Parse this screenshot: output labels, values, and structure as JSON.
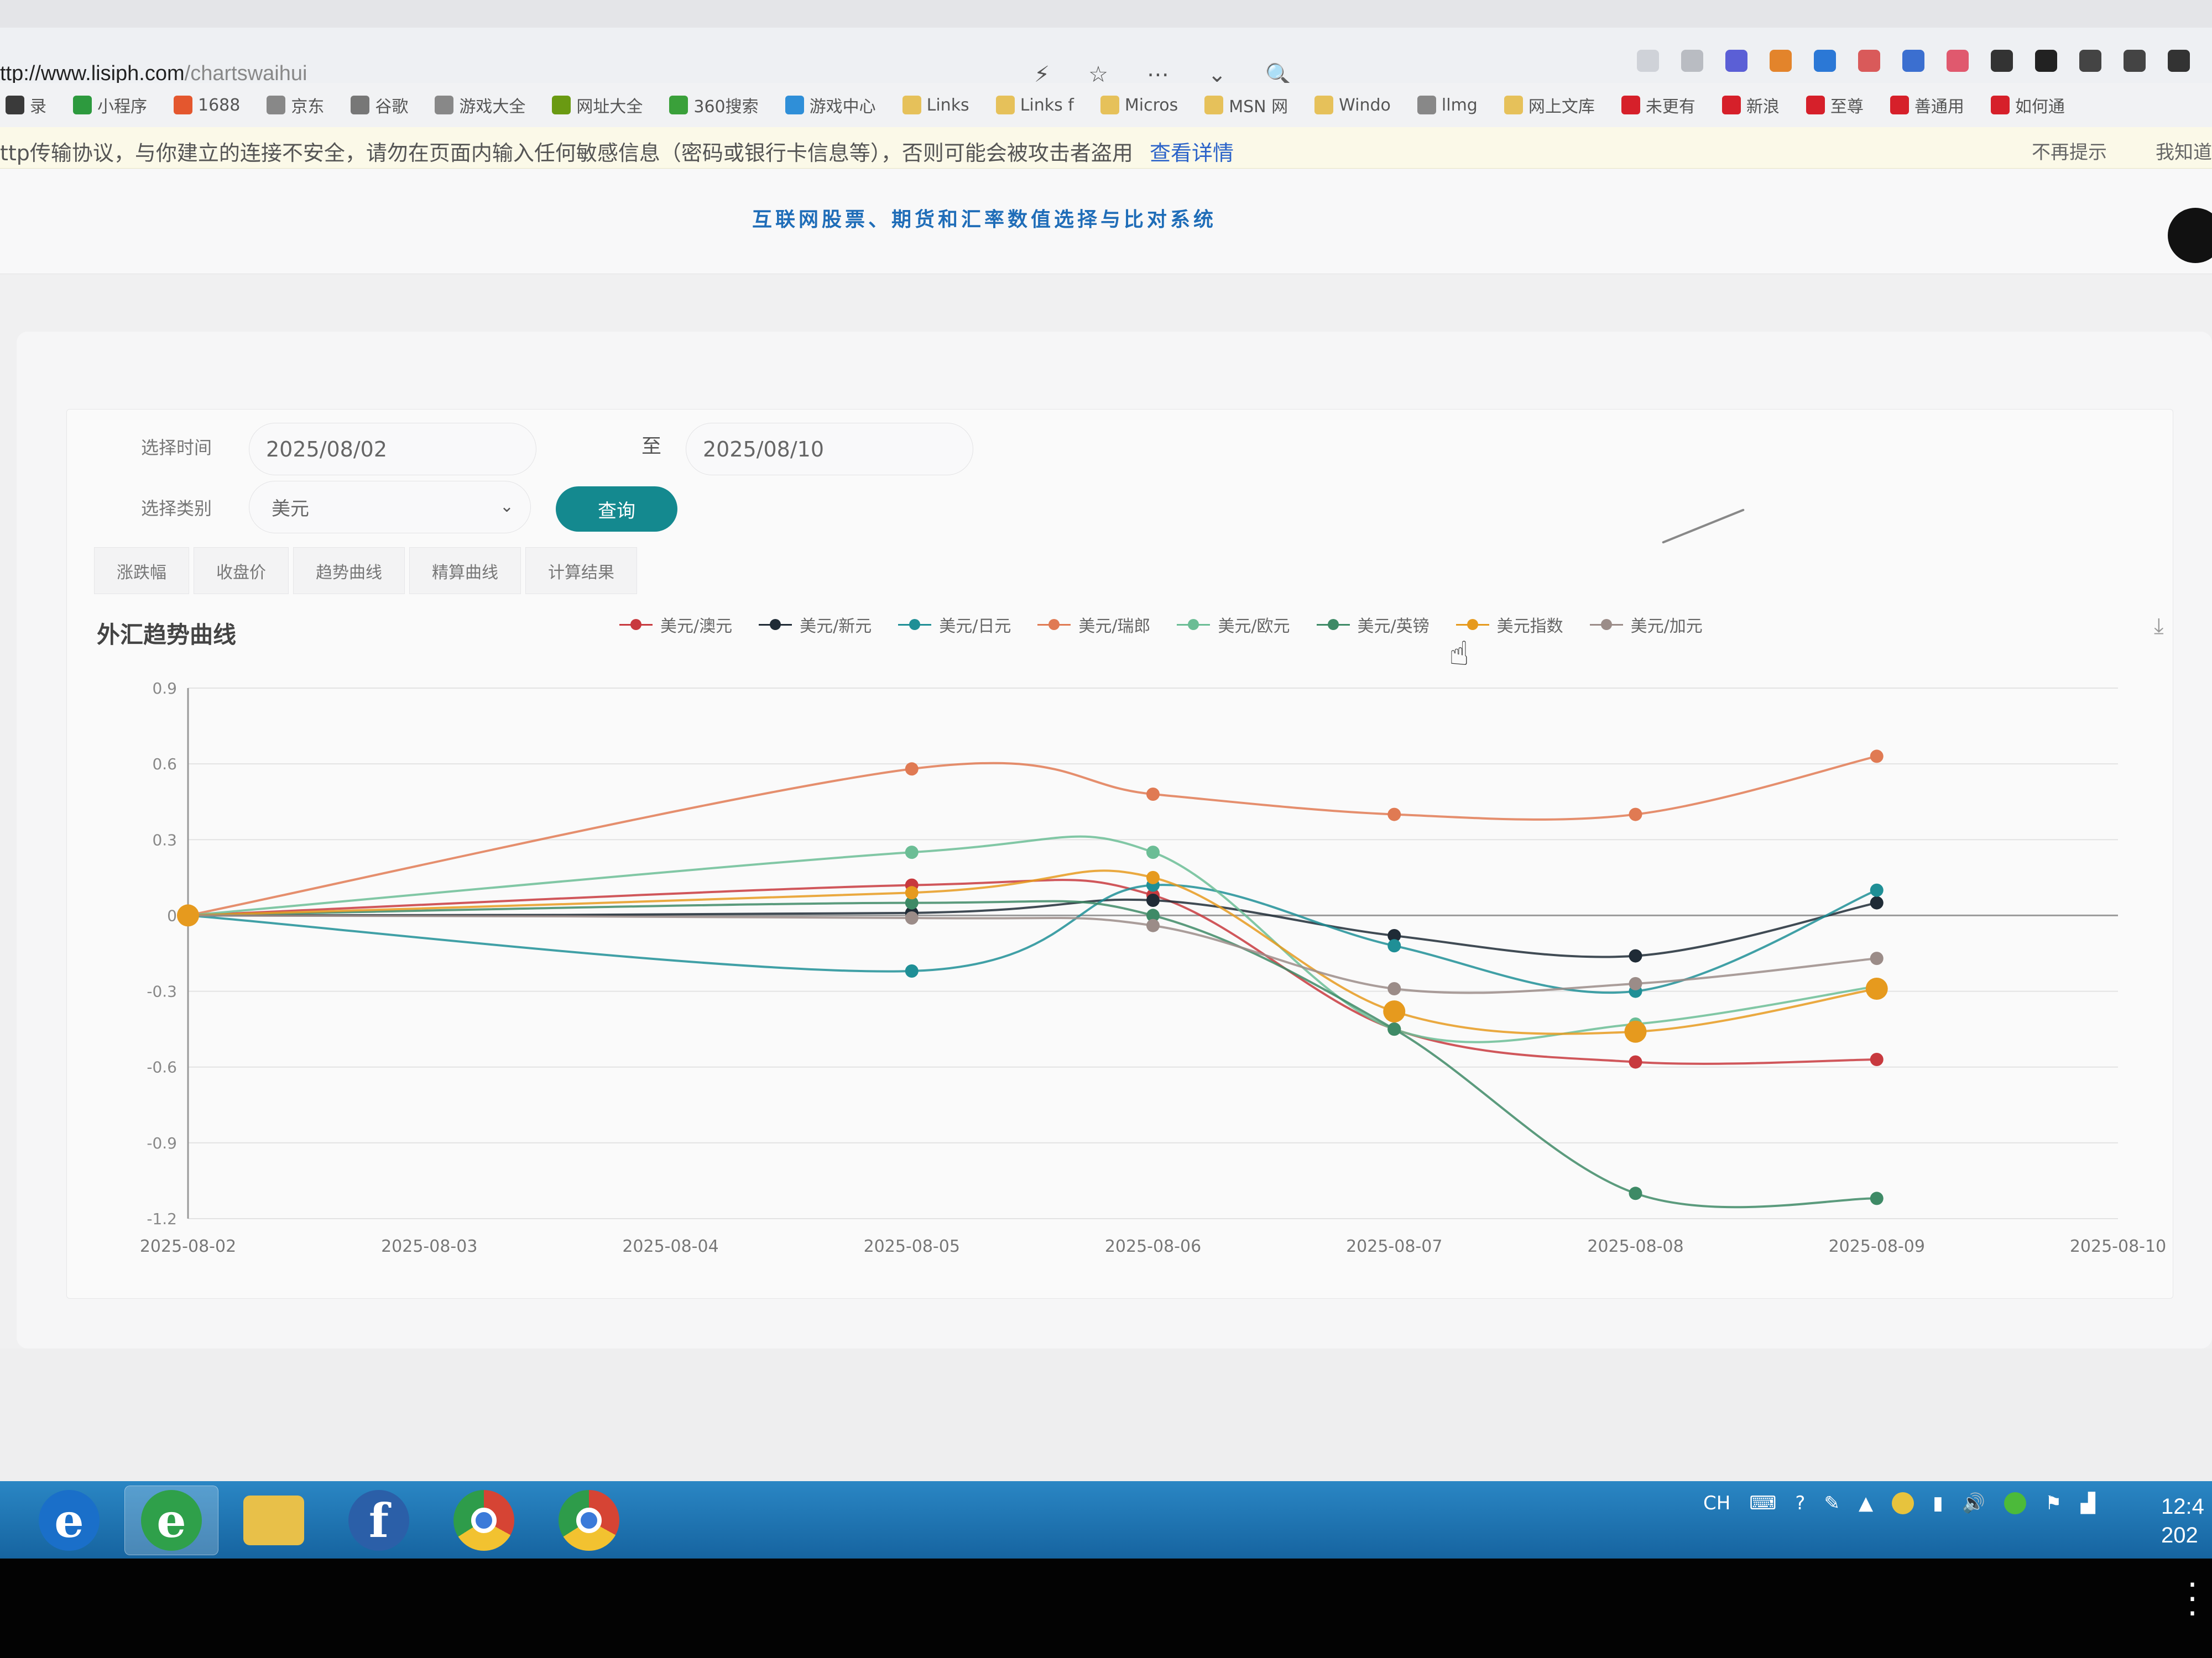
{
  "browser": {
    "url": "ttp://www.lisiph.com/chartswaihui",
    "url_domain": "ttp://www.lisiph.com",
    "url_path": "/chartswaihui",
    "bookmarks": [
      {
        "label": "录",
        "icon": "folder-icon",
        "color": "#3a3a3a"
      },
      {
        "label": "小程序",
        "icon": "app-icon",
        "color": "#2d9a3e"
      },
      {
        "label": "1688",
        "icon": "shop-icon",
        "color": "#e4572e"
      },
      {
        "label": "京东",
        "icon": "link-icon",
        "color": "#888888"
      },
      {
        "label": "谷歌",
        "icon": "google-icon",
        "color": "#777777"
      },
      {
        "label": "游戏大全",
        "icon": "link-icon",
        "color": "#888888"
      },
      {
        "label": "网址大全",
        "icon": "globe-icon",
        "color": "#6a9a12"
      },
      {
        "label": "360搜索",
        "icon": "search-icon",
        "color": "#3aa03a"
      },
      {
        "label": "游戏中心",
        "icon": "game-icon",
        "color": "#2f8fd8"
      },
      {
        "label": "Links",
        "icon": "folder-icon",
        "color": "#e6c15a"
      },
      {
        "label": "Links f",
        "icon": "folder-icon",
        "color": "#e6c15a"
      },
      {
        "label": "Micros",
        "icon": "folder-icon",
        "color": "#e6c15a"
      },
      {
        "label": "MSN 网",
        "icon": "folder-icon",
        "color": "#e6c15a"
      },
      {
        "label": "Windo",
        "icon": "folder-icon",
        "color": "#e6c15a"
      },
      {
        "label": "llmg",
        "icon": "link-icon",
        "color": "#888888"
      },
      {
        "label": "网上文库",
        "icon": "folder-icon",
        "color": "#e6c15a"
      },
      {
        "label": "未更有",
        "icon": "weibo-icon",
        "color": "#d6202a"
      },
      {
        "label": "新浪",
        "icon": "weibo-icon",
        "color": "#d6202a"
      },
      {
        "label": "至尊",
        "icon": "weibo-icon",
        "color": "#d6202a"
      },
      {
        "label": "善通用",
        "icon": "weibo-icon",
        "color": "#d6202a"
      },
      {
        "label": "如何通",
        "icon": "weibo-icon",
        "color": "#d6202a"
      }
    ],
    "warning": {
      "text": "ttp传输协议，与你建立的连接不安全，请勿在页面内输入任何敏感信息（密码或银行卡信息等），否则可能会被攻击者盗用",
      "link": "查看详情",
      "dismiss": "不再提示",
      "ok": "我知道"
    }
  },
  "page": {
    "title": "互联网股票、期货和汇率数值选择与比对系统"
  },
  "form": {
    "time_label": "选择时间",
    "start_date": "2025/08/02",
    "to_label": "至",
    "end_date": "2025/08/10",
    "category_label": "选择类别",
    "category_value": "美元",
    "query_button": "查询"
  },
  "tabs": [
    {
      "label": "涨跌幅"
    },
    {
      "label": "收盘价"
    },
    {
      "label": "趋势曲线"
    },
    {
      "label": "精算曲线"
    },
    {
      "label": "计算结果"
    }
  ],
  "chart_data": {
    "type": "line",
    "title": "外汇趋势曲线",
    "x": [
      "2025-08-02",
      "2025-08-03",
      "2025-08-04",
      "2025-08-05",
      "2025-08-06",
      "2025-08-07",
      "2025-08-08",
      "2025-08-09",
      "2025-08-10"
    ],
    "ylim": [
      -1.2,
      0.9
    ],
    "yticks": [
      0.9,
      0.6,
      0.3,
      0,
      -0.3,
      -0.6,
      -0.9,
      -1.2
    ],
    "grid": true,
    "legend_position": "top",
    "series": [
      {
        "name": "美元/澳元",
        "color": "#c8393e",
        "points": [
          [
            0,
            0
          ],
          [
            3,
            0.12
          ],
          [
            4,
            0.08
          ],
          [
            5,
            -0.45
          ],
          [
            6,
            -0.58
          ],
          [
            7,
            -0.57
          ]
        ]
      },
      {
        "name": "美元/新元",
        "color": "#1f2b36",
        "points": [
          [
            0,
            0
          ],
          [
            3,
            0.01
          ],
          [
            4,
            0.06
          ],
          [
            5,
            -0.08
          ],
          [
            6,
            -0.16
          ],
          [
            7,
            0.05
          ]
        ]
      },
      {
        "name": "美元/日元",
        "color": "#1f8f96",
        "points": [
          [
            0,
            0
          ],
          [
            3,
            -0.22
          ],
          [
            4,
            0.12
          ],
          [
            5,
            -0.12
          ],
          [
            6,
            -0.3
          ],
          [
            7,
            0.1
          ]
        ]
      },
      {
        "name": "美元/瑞郎",
        "color": "#e07a53",
        "points": [
          [
            0,
            0
          ],
          [
            3,
            0.58
          ],
          [
            4,
            0.48
          ],
          [
            5,
            0.4
          ],
          [
            6,
            0.4
          ],
          [
            7,
            0.63
          ]
        ]
      },
      {
        "name": "美元/欧元",
        "color": "#6bbd95",
        "points": [
          [
            0,
            0
          ],
          [
            3,
            0.25
          ],
          [
            4,
            0.25
          ],
          [
            5,
            -0.45
          ],
          [
            6,
            -0.43
          ],
          [
            7,
            -0.28
          ]
        ]
      },
      {
        "name": "美元/英镑",
        "color": "#3e8a66",
        "points": [
          [
            0,
            0
          ],
          [
            3,
            0.05
          ],
          [
            4,
            0.0
          ],
          [
            5,
            -0.45
          ],
          [
            6,
            -1.1
          ],
          [
            7,
            -1.12
          ]
        ]
      },
      {
        "name": "美元指数",
        "color": "#e69a1e",
        "points": [
          [
            0,
            0
          ],
          [
            3,
            0.09
          ],
          [
            4,
            0.15
          ],
          [
            5,
            -0.38
          ],
          [
            6,
            -0.46
          ],
          [
            7,
            -0.29
          ]
        ]
      },
      {
        "name": "美元/加元",
        "color": "#9b8c88",
        "points": [
          [
            0,
            0
          ],
          [
            3,
            -0.01
          ],
          [
            4,
            -0.04
          ],
          [
            5,
            -0.29
          ],
          [
            6,
            -0.27
          ],
          [
            7,
            -0.17
          ]
        ]
      }
    ]
  },
  "taskbar": {
    "apps": [
      {
        "name": "ie-old-icon",
        "glyph": "e",
        "color": "#1a6fc9"
      },
      {
        "name": "ie-icon",
        "glyph": "e",
        "color": "#2fa04a"
      },
      {
        "name": "folder-icon",
        "glyph": "",
        "color": "#e8c049"
      },
      {
        "name": "flash-icon",
        "glyph": "f",
        "color": "#2b5fa8"
      },
      {
        "name": "chrome-icon",
        "glyph": "",
        "color": "#d64434"
      },
      {
        "name": "chrome-icon-2",
        "glyph": "",
        "color": "#d64434"
      }
    ],
    "tray_lang": "CH",
    "clock_time": "12:4",
    "clock_date": "202"
  }
}
